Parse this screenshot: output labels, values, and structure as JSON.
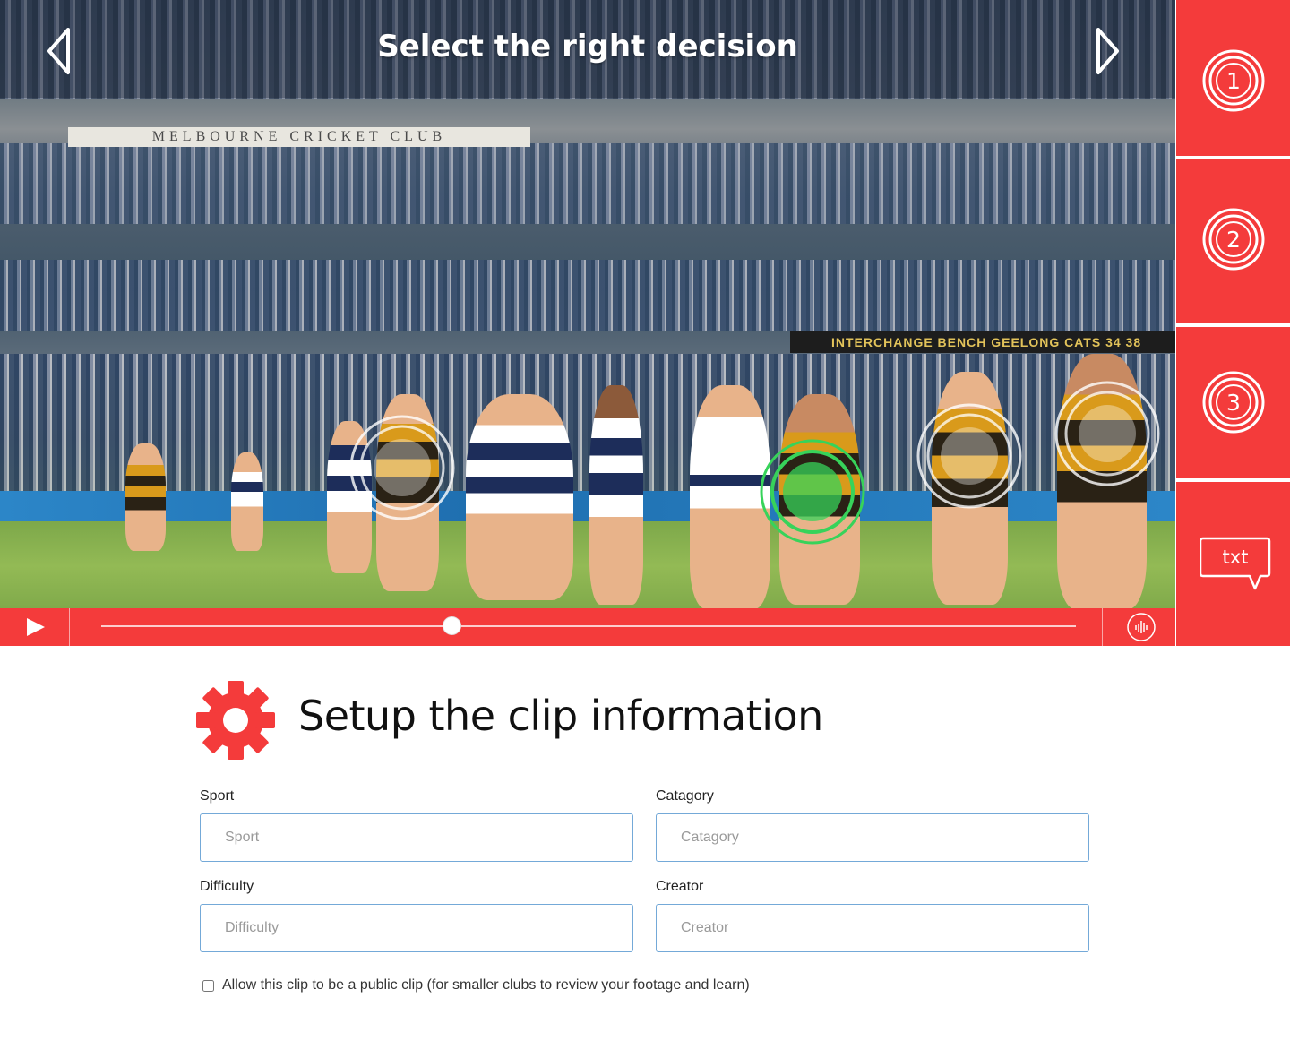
{
  "video": {
    "title": "Select the right decision",
    "stadium_sign": "MELBOURNE CRICKET CLUB",
    "bench_sign": "INTERCHANGE BENCH   GEELONG CATS   34  38",
    "progress": 0.36,
    "icons": {
      "prev": "chevron-left-icon",
      "next": "chevron-right-icon",
      "play": "play-icon",
      "volume": "volume-icon"
    }
  },
  "sidebar": {
    "items": [
      {
        "label": "1",
        "icon": "numbered-target-icon"
      },
      {
        "label": "2",
        "icon": "numbered-target-icon"
      },
      {
        "label": "3",
        "icon": "numbered-target-icon"
      },
      {
        "label": "txt",
        "icon": "speech-bubble-icon"
      }
    ]
  },
  "form": {
    "title": "Setup the clip information",
    "icon": "gear-icon",
    "fields": {
      "sport": {
        "label": "Sport",
        "placeholder": "Sport",
        "value": ""
      },
      "category": {
        "label": "Catagory",
        "placeholder": "Catagory",
        "value": ""
      },
      "difficulty": {
        "label": "Difficulty",
        "placeholder": "Difficulty",
        "value": ""
      },
      "creator": {
        "label": "Creator",
        "placeholder": "Creator",
        "value": ""
      }
    },
    "public_clip": {
      "label": "Allow this clip to be a public clip (for smaller clubs to review your footage and learn)",
      "checked": false
    }
  },
  "colors": {
    "accent": "#f43b3b",
    "target_selected": "#37d35a",
    "input_border": "#74a9d8"
  }
}
